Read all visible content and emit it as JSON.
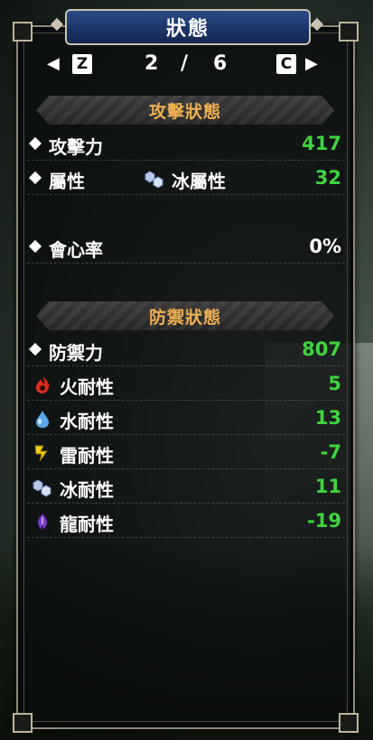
{
  "header": {
    "title": "狀態"
  },
  "pager": {
    "left_key": "Z",
    "right_key": "C",
    "current": "2",
    "separator": "/",
    "total": "6",
    "left_arrow": "◀",
    "right_arrow": "▶"
  },
  "attack": {
    "title": "攻擊狀態",
    "rows": [
      {
        "label": "攻擊力",
        "value": "417"
      },
      {
        "label": "屬性",
        "element": "冰屬性",
        "value": "32"
      },
      {
        "label": "會心率",
        "value": "0%"
      }
    ]
  },
  "defense": {
    "title": "防禦狀態",
    "rows": [
      {
        "label": "防禦力",
        "value": "807"
      },
      {
        "label": "火耐性",
        "value": "5",
        "icon": "fire-icon"
      },
      {
        "label": "水耐性",
        "value": "13",
        "icon": "water-icon"
      },
      {
        "label": "雷耐性",
        "value": "-7",
        "icon": "thunder-icon"
      },
      {
        "label": "冰耐性",
        "value": "11",
        "icon": "ice-icon"
      },
      {
        "label": "龍耐性",
        "value": "-19",
        "icon": "dragon-icon"
      }
    ]
  },
  "colors": {
    "positive": "#3fd43f",
    "neutral": "#ffffff",
    "section_title": "#f0b052",
    "title_plate": "#1b3366"
  }
}
